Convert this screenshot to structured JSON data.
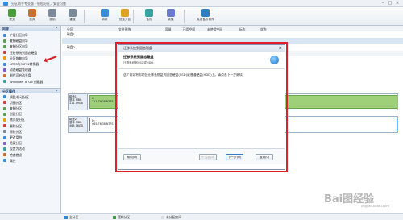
{
  "titlebar": {
    "title": "分区助手专业版 - 轻松分区，安全可靠"
  },
  "toolbar": [
    {
      "label": "提交",
      "color": "#4a9b3a"
    },
    {
      "label": "放弃",
      "color": "#c87030"
    },
    {
      "label": "撤销",
      "color": "#7a8a9a"
    },
    {
      "label": "重做",
      "color": "#7a8a9a"
    },
    {
      "label": "刷新",
      "color": "#3a8ed8"
    },
    {
      "label": "快速分区",
      "color": "#e0a020"
    },
    {
      "label": "备份",
      "color": "#3aa0a0"
    },
    {
      "label": "克隆",
      "color": "#6a7ad0"
    },
    {
      "label": "免费备份软件",
      "color": "#2a80c0"
    }
  ],
  "sidebar": {
    "wizards_title": "向导",
    "wizards": [
      {
        "label": "扩展分区向导",
        "color": "#3a8ed8"
      },
      {
        "label": "复制磁盘向导",
        "color": "#5aa050"
      },
      {
        "label": "复制分区向导",
        "color": "#5aa050"
      },
      {
        "label": "迁移系统到固态硬盘",
        "color": "#d04040"
      },
      {
        "label": "分区恢复向导",
        "color": "#e0a020"
      },
      {
        "label": "NTFS与FAT32转换器",
        "color": "#3a8ed8"
      },
      {
        "label": "动态磁盘管理器",
        "color": "#7a60c0"
      },
      {
        "label": "制作可启动光盘",
        "color": "#c87030"
      },
      {
        "label": "Windows To Go 创建器",
        "color": "#3aa0a0"
      }
    ],
    "ops_title": "分区操作",
    "ops": [
      {
        "label": "调整/移动分区",
        "color": "#3a8ed8"
      },
      {
        "label": "切割分区",
        "color": "#d04040"
      },
      {
        "label": "复制分区",
        "color": "#5aa050"
      },
      {
        "label": "创建分区",
        "color": "#5aa050"
      },
      {
        "label": "格式化分区",
        "color": "#e0a020"
      },
      {
        "label": "删除分区",
        "color": "#d04040"
      },
      {
        "label": "擦除分区",
        "color": "#7a8a9a"
      },
      {
        "label": "更改盘符",
        "color": "#3a8ed8"
      },
      {
        "label": "隐藏分区",
        "color": "#7a60c0"
      },
      {
        "label": "设置为活动",
        "color": "#3aa0a0"
      },
      {
        "label": "检查错误",
        "color": "#c87030"
      },
      {
        "label": "属性",
        "color": "#3a8ed8"
      }
    ]
  },
  "main": {
    "columns": [
      "分区",
      "文件系统",
      "容量",
      "已用空间",
      "未使用空间",
      "标志",
      "状态"
    ],
    "disk1_row": "磁盘1",
    "disk2_row": "磁盘2",
    "disks": [
      {
        "name": "磁盘1",
        "type": "基本 MBR",
        "size": "111.79GB",
        "part_label": "C:",
        "part_info": "111.79GB NTFS"
      },
      {
        "name": "磁盘2",
        "type": "基本 MBR",
        "size": "465.76GB",
        "part_label": "D:",
        "part_info": "465.76GB NTFS"
      }
    ]
  },
  "dialog": {
    "window_title": "迁移系统到固态磁盘",
    "heading": "迁移系统到固态磁盘",
    "subheading": "迁移系统到SSD或HDD。",
    "body": "这个向导将帮助您迁移系统盘到固态硬盘(SSD)或普通硬盘(HDD)上。请点击下一步继续。",
    "btn_help": "帮助(H)",
    "btn_back": "< 后退(B)",
    "btn_next": "下一步(N)",
    "btn_cancel": "取消(C)"
  },
  "statusbar": {
    "legend": [
      {
        "label": "主分区",
        "color": "#2f8ad8"
      },
      {
        "label": "逻辑分区",
        "color": "#3a9e4a"
      },
      {
        "label": "未分配空间",
        "color": "#d7dde3"
      }
    ]
  },
  "watermark": {
    "logo": "Bai图经验",
    "sub": "jingyan.baidu.com"
  }
}
